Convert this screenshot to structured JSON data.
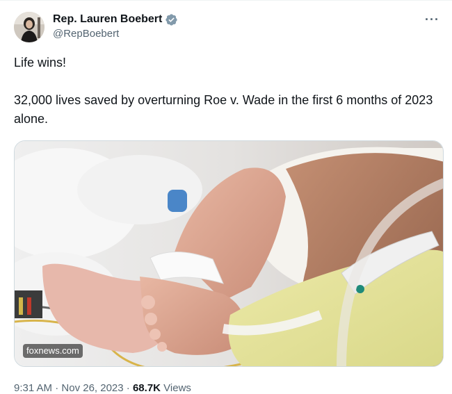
{
  "author": {
    "display_name": "Rep. Lauren Boebert",
    "handle": "@RepBoebert",
    "avatar_icon": "profile-photo",
    "verified_icon": "verified-badge-icon",
    "verified_color": "#829aab"
  },
  "menu": {
    "more_label": "···"
  },
  "tweet": {
    "paragraph_1": "Life wins!",
    "paragraph_2": "32,000 lives saved by overturning Roe v. Wade in the first 6 months of 2023 alone."
  },
  "media": {
    "source_label": "foxnews.com"
  },
  "meta": {
    "time": "9:31 AM",
    "separator": "·",
    "date": "Nov 26, 2023",
    "views_count": "68.7K",
    "views_label": "Views"
  },
  "colors": {
    "text_primary": "#0f1419",
    "text_secondary": "#536471",
    "border": "#cfd9de"
  }
}
